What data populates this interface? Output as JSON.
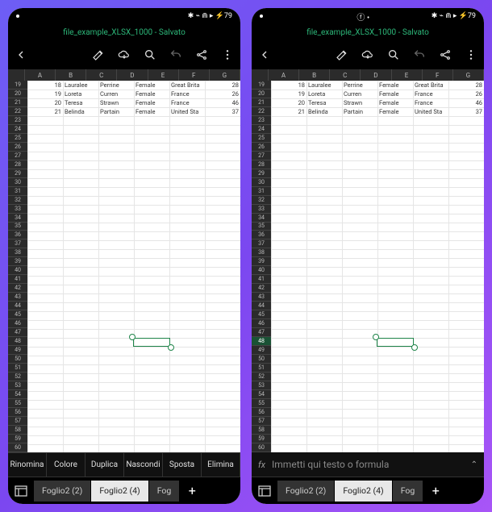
{
  "file_title": "file_example_XLSX_1000 - Salvato",
  "status_icons": "✱ ⌁ ⋒ ▸  ⚡79",
  "columns": [
    "A",
    "B",
    "C",
    "D",
    "E",
    "F",
    "G"
  ],
  "row_start": 19,
  "row_end": 60,
  "data_rows": [
    {
      "r": 19,
      "a": "18",
      "b": "Lauralee",
      "c": "Perrine",
      "d": "Female",
      "e": "Great Brita",
      "f": "28"
    },
    {
      "r": 20,
      "a": "19",
      "b": "Loreta",
      "c": "Curren",
      "d": "Female",
      "e": "France",
      "f": "26"
    },
    {
      "r": 21,
      "a": "20",
      "b": "Teresa",
      "c": "Strawn",
      "d": "Female",
      "e": "France",
      "f": "46"
    },
    {
      "r": 22,
      "a": "21",
      "b": "Belinda",
      "c": "Partain",
      "d": "Female",
      "e": "United Sta",
      "f": "37"
    }
  ],
  "context_menu": [
    "Rinomina",
    "Colore",
    "Duplica",
    "Nascondi",
    "Sposta",
    "Elimina"
  ],
  "formula_label": "fx",
  "formula_placeholder": "Immetti qui testo o formula",
  "tabs": [
    {
      "label": "Foglio2 (2)",
      "active": false
    },
    {
      "label": "Foglio2 (4)",
      "active": true
    },
    {
      "label": "Fog",
      "active": false
    }
  ],
  "selected_row_left": null,
  "selected_row_right": 48
}
